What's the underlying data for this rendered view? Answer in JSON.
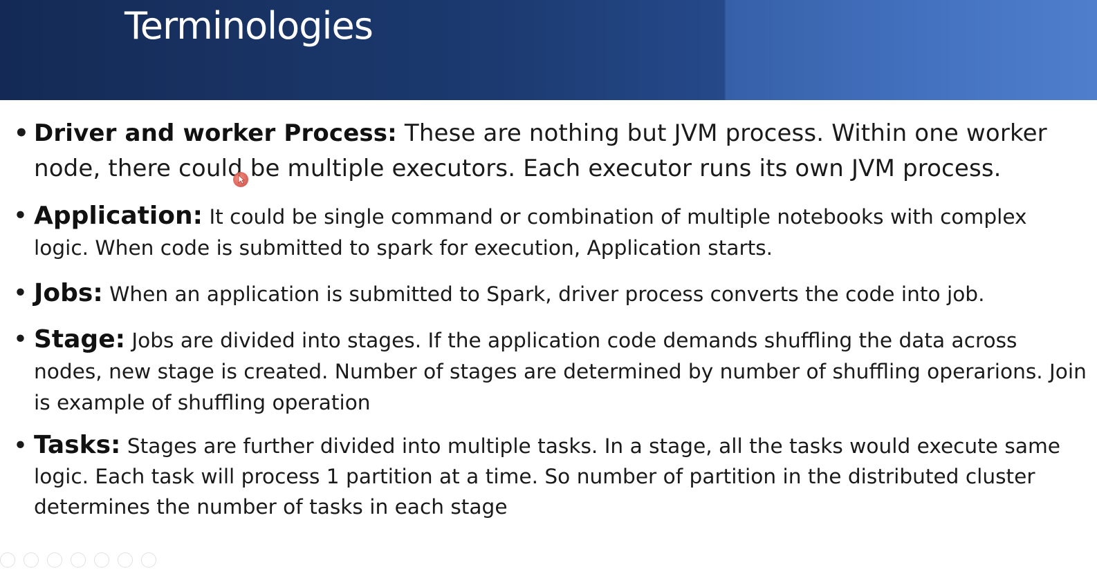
{
  "slide": {
    "title": "Terminologies",
    "bullet_symbol": "•",
    "bullets": [
      {
        "term": "Driver and worker Process:",
        "text": " These are nothing but JVM process. Within one worker node, there could be multiple executors. Each executor runs its own JVM process."
      },
      {
        "term": "Application:",
        "text": " It could be single command or combination of multiple notebooks with complex logic. When code is submitted to spark for execution, Application starts."
      },
      {
        "term": "Jobs:",
        "text": " When an application is submitted to Spark, driver process converts the code into job."
      },
      {
        "term": "Stage:",
        "text": " Jobs are divided into stages. If the application code demands shuffling the data across nodes, new stage is created. Number of stages are determined by number of shuffling operarions. Join is example of shuffling operation"
      },
      {
        "term": "Tasks:",
        "text": " Stages are further divided into multiple tasks. In a stage, all the tasks would execute same logic. Each task will process 1 partition at a time. So number of partition in the distributed cluster determines the number of tasks in each stage"
      }
    ]
  },
  "colors": {
    "header_dark": "#142a55",
    "header_light": "#4f7fcc",
    "title_text": "#ffffff",
    "body_text": "#1a1a1a",
    "pointer": "#d9544a"
  },
  "icons": {
    "pointer": "laser-pointer-icon",
    "toolbar": [
      "previous-slide-icon",
      "next-slide-icon",
      "pen-icon",
      "slides-icon",
      "zoom-icon",
      "subtitles-icon",
      "more-options-icon"
    ]
  }
}
